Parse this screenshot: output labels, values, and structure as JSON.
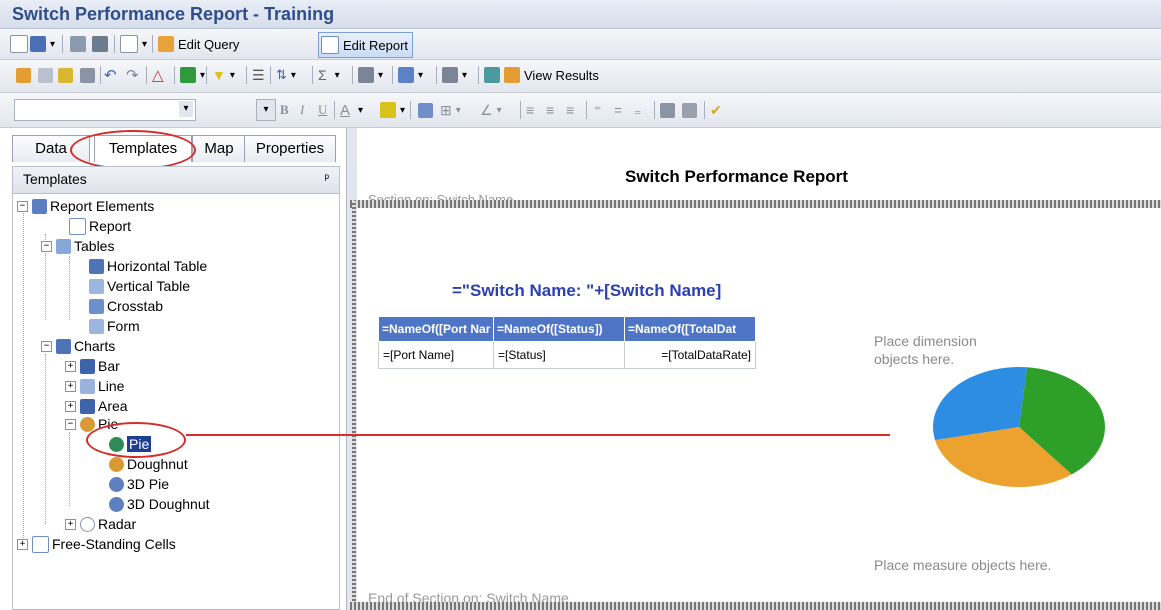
{
  "window": {
    "title": "Switch Performance Report - Training"
  },
  "toolbar1": {
    "edit_query": "Edit Query",
    "edit_report": "Edit Report"
  },
  "toolbar2": {
    "view_results": "View Results"
  },
  "toolbar3": {
    "bold": "B",
    "italic": "I",
    "underline": "U",
    "font_color": "A"
  },
  "left_panel": {
    "tabs": [
      "Data",
      "Templates",
      "Map",
      "Properties"
    ],
    "active_tab": "Templates",
    "header": "Templates",
    "pin": "ᵖ"
  },
  "tree": {
    "report_elements": "Report Elements",
    "report": "Report",
    "tables": "Tables",
    "horizontal_table": "Horizontal Table",
    "vertical_table": "Vertical Table",
    "crosstab": "Crosstab",
    "form": "Form",
    "charts": "Charts",
    "bar": "Bar",
    "line": "Line",
    "area": "Area",
    "pie_group": "Pie",
    "pie": "Pie",
    "doughnut": "Doughnut",
    "pie3d": "3D Pie",
    "doughnut3d": "3D Doughnut",
    "radar": "Radar",
    "free_cells": "Free-Standing Cells"
  },
  "report": {
    "title": "Switch Performance Report",
    "section_start": "Section on: Switch Name",
    "section_end": "End of Section on: Switch Name",
    "switch_name_formula": "=\"Switch Name: \"+[Switch Name]",
    "table_headers": [
      "=NameOf([Port Nar",
      "=NameOf([Status])",
      "=NameOf([TotalDat"
    ],
    "table_row": [
      "=[Port Name]",
      "=[Status]",
      "=[TotalDataRate]"
    ],
    "dimension_hint": "Place dimension objects here.",
    "measure_hint": "Place measure objects here."
  },
  "pie_chart": {
    "slices": [
      {
        "color": "#2ea02a",
        "fraction": 0.38
      },
      {
        "color": "#eda12e",
        "fraction": 0.32
      },
      {
        "color": "#2d8de3",
        "fraction": 0.3
      }
    ]
  },
  "colors": {
    "accent": "#2e4d8a",
    "header_blue": "#4f76c6",
    "annotation_red": "#d42b2b"
  }
}
